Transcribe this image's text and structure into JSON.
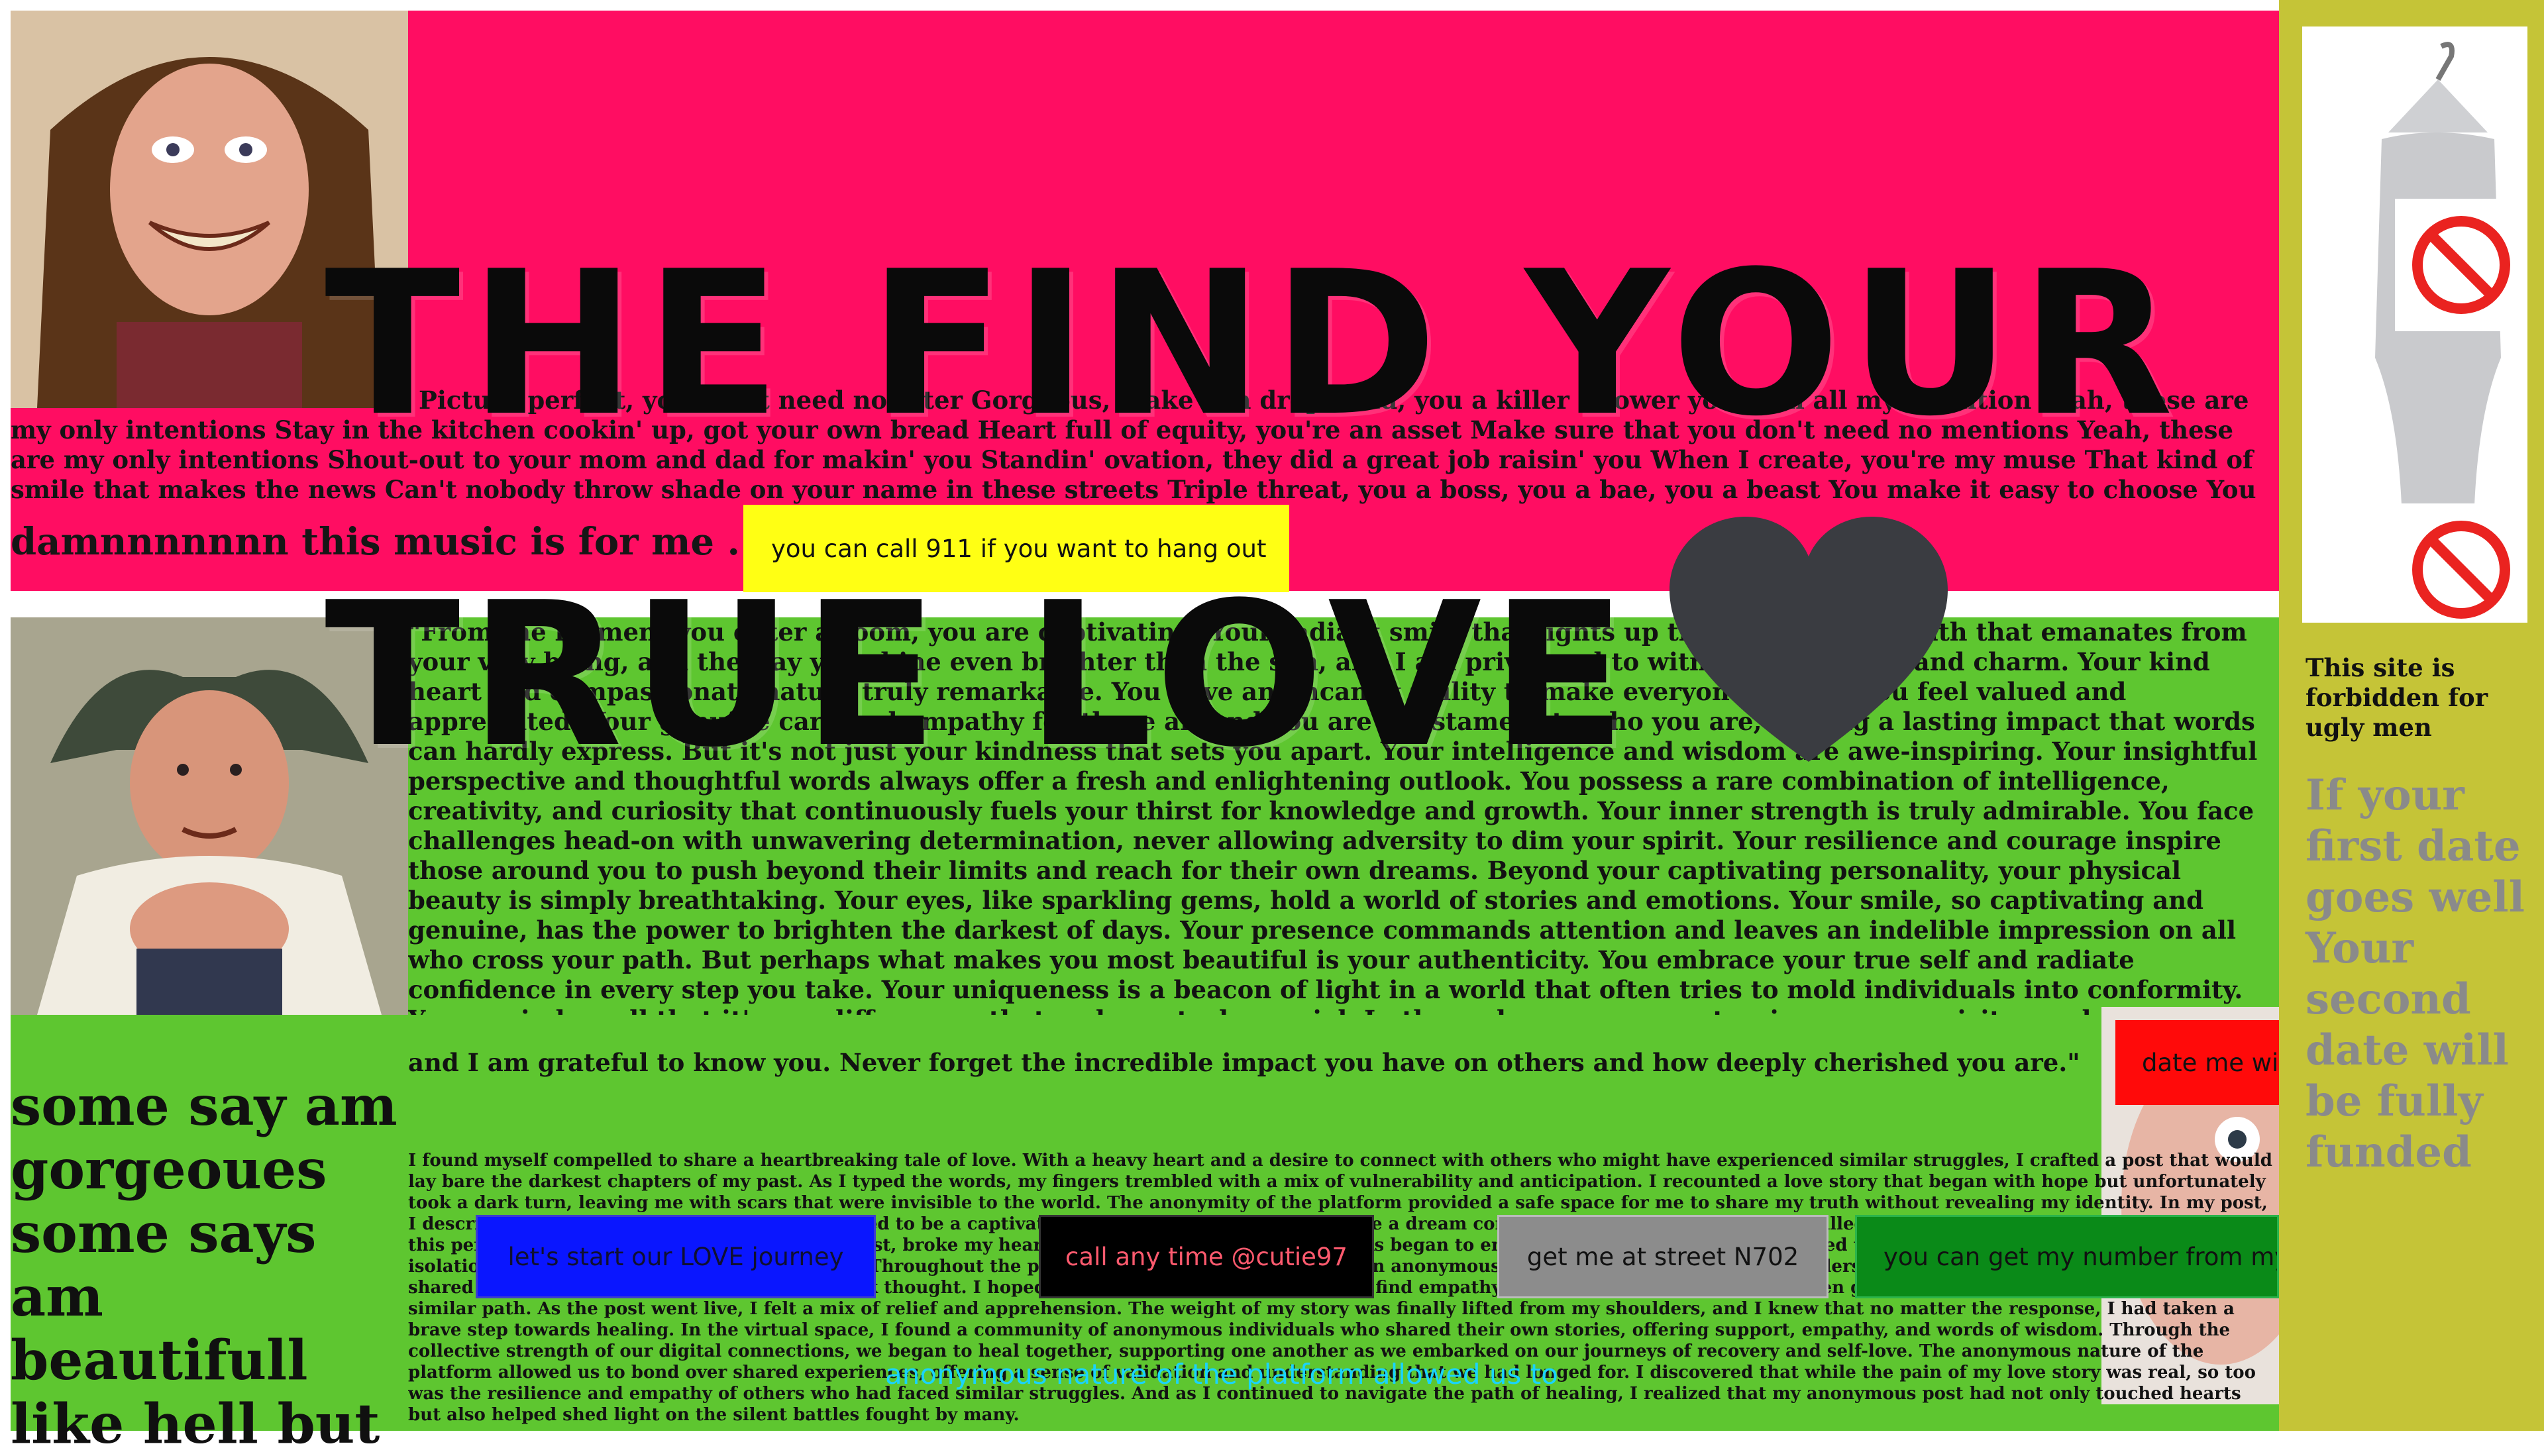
{
  "title": {
    "line1": "THE FIND YOUR",
    "line2": "TRUE LOVE"
  },
  "lyrics": {
    "text": "Picture perfect, you don't need no filter Gorgeous, make 'em drop dead, you a killer Shower you with all my attention Yeah, these are my only intentions Stay in the kitchen cookin' up, got your own bread Heart full of equity, you're an asset Make sure that you don't need no mentions Yeah, these are my only intentions Shout-out to your mom and dad for makin' you Standin' ovation, they did a great job raisin' you When I create, you're my muse That kind of smile that makes the news Can't nobody throw shade on your name in these streets Triple threat, you a boss, you a bae, you a beast You make it easy to choose You got a mean touch, I can't refuse (No, I can't refuse it)"
  },
  "music_line": "damnnnnnnn this music is for me .",
  "buttons": {
    "call_911": "you can call 911 if you want to hang out",
    "date_me": "date me with",
    "journey": "let's start our LOVE journey",
    "call_any_time": "call any time @cutie97",
    "street": "get me at street N702",
    "number": "you can get my number from my"
  },
  "praise": {
    "text": "\"From the moment you enter a room, you are captivating. Your radiant smile that lights up the room, the warmth that emanates from your very being, and the way you shine even brighter than the sun, and I am privileged to witness your grace and charm. Your kind heart and compassionate nature truly remarkable. You have an uncanny ability to make everyone around you feel valued and appreciated. Your genuine care and empathy for those around you are a testament to who you are, leaving a lasting impact that words can hardly express. But it's not just your kindness that sets you apart. Your intelligence and wisdom are awe-inspiring. Your insightful perspective and thoughtful words always offer a fresh and enlightening outlook. You possess a rare combination of intelligence, creativity, and curiosity that continuously fuels your thirst for knowledge and growth. Your inner strength is truly admirable. You face challenges head-on with unwavering determination, never allowing adversity to dim your spirit. Your resilience and courage inspire those around you to push beyond their limits and reach for their own dreams. Beyond your captivating personality, your physical beauty is simply breathtaking. Your eyes, like sparkling gems, hold a world of stories and emotions. Your smile, so captivating and genuine, has the power to brighten the darkest of days. Your presence commands attention and leaves an indelible impression on all who cross your path. But perhaps what makes you most beautiful is your authenticity. You embrace your true self and radiate confidence in every step you take. Your uniqueness is a beacon of light in a world that often tries to mold individuals into conformity. You remind us all that it's our differences that make us truly special. In the end, you are a masterpiece—an exquisite combination of strength, kindness, intelligence, and beauty. Your presence makes the world a more beautiful place,",
    "closing": "and I am grateful to know you. Never forget the incredible impact you have on others and how deeply cherished you are.\""
  },
  "story": {
    "text": "I found myself compelled to share a heartbreaking tale of love. With a heavy heart and a desire to connect with others who might have experienced similar struggles, I crafted a post that would lay bare the darkest chapters of my past. As I typed the words, my fingers trembled with a mix of vulnerability and anticipation. I recounted a love story that began with hope but unfortunately took a dark turn, leaving me with scars that were invisible to the world. The anonymity of the platform provided a safe space for me to share my truth without revealing my identity. In my post, I described an encounter with someone I believed to be a captivating soul, a person who seemed like a dream come true. We built a life together, filled with laughter and shared dreams. But this person, who would eventually betray my trust, broke my heart. However, as time went on, cracks began to emerge in our relationship. I revealed the pain I endured, the manipulation and isolation from my loved ones. I brought me joy. Throughout the post, I poured out my emotions to an anonymous audience, seeking solace and understanding from an online community. I shared the hope that my experience would spark thought. I hoped that by sharing my story, I would find empathy, encouragement, and perhaps even guidance from those who had walked a similar path. As the post went live, I felt a mix of relief and apprehension. The weight of my story was finally lifted from my shoulders, and I knew that no matter the response, I had taken a brave step towards healing. In the virtual space, I found a community of anonymous individuals who shared their own stories, offering support, empathy, and words of wisdom. Through the collective strength of our digital connections, we began to heal together, supporting one another as we embarked on our journeys of recovery and self-love. The anonymous nature of the platform allowed us to bond over shared experiences, offering a sense of validation and understanding that we had longed for. I discovered that while the pain of my love story was real, so too was the resilience and empathy of others who had faced similar struggles. And as I continued to navigate the path of healing, I realized that my anonymous post had not only touched hearts but also helped shed light on the silent battles fought by many."
  },
  "gorgeous_text": "some say am gorgeoues some says am beautifull like hell but",
  "cyan_text": "anonymous nature of the platform allowed us to",
  "sidebar": {
    "forbidden": "This site is forbidden for ugly men",
    "date": "If your first date goes well Your second date will be fully funded"
  },
  "icons": [
    "heart-icon",
    "prohibited-icon",
    "mannequin-hanger-icon"
  ],
  "colors": {
    "pink": "#ff0d62",
    "green": "#5ec630",
    "sidebar": "#c5c437",
    "yellow_button": "#ffff14",
    "blue_button": "#0a16ff",
    "red_button": "#ff0a0a"
  }
}
